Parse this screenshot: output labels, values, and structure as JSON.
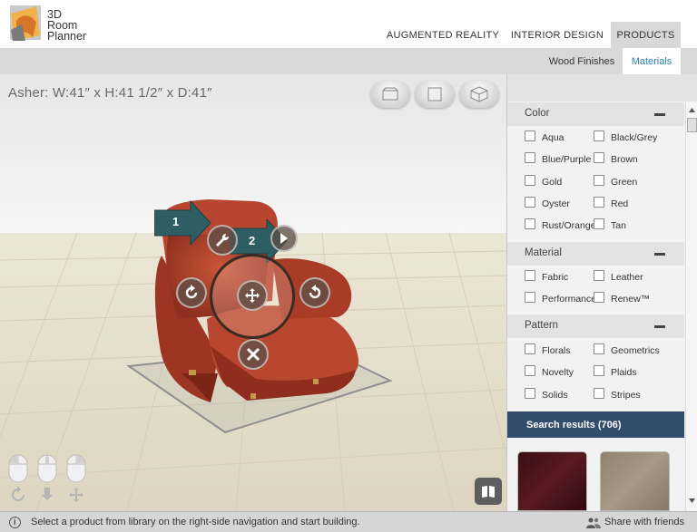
{
  "app": {
    "logo_text": [
      "3D",
      "Room",
      "Planner"
    ]
  },
  "top_nav": {
    "items": [
      "AUGMENTED REALITY",
      "INTERIOR DESIGN",
      "PRODUCTS"
    ],
    "active": "PRODUCTS"
  },
  "sub_nav": {
    "items": [
      "Wood Finishes",
      "Materials"
    ],
    "active": "Materials"
  },
  "viewport": {
    "product_label": "Asher: W:41″ x H:41 1/2″ x D:41″",
    "view_buttons": [
      "view-2d-icon",
      "view-top-icon",
      "view-3d-icon"
    ],
    "step_markers": [
      "1",
      "2"
    ],
    "controls": [
      "wrench-icon",
      "rotate-left-icon",
      "move-icon",
      "rotate-right-icon",
      "delete-icon",
      "next-arrow-icon"
    ],
    "mouse_hints": [
      "mouse-left-icon",
      "mouse-middle-icon",
      "mouse-right-icon"
    ]
  },
  "filters": {
    "sections": [
      {
        "title": "Color",
        "options": [
          "Aqua",
          "Black/Grey",
          "Blue/Purple",
          "Brown",
          "Gold",
          "Green",
          "Oyster",
          "Red",
          "Rust/Orange",
          "Tan"
        ]
      },
      {
        "title": "Material",
        "options": [
          "Fabric",
          "Leather",
          "Performance",
          "Renew™"
        ]
      },
      {
        "title": "Pattern",
        "options": [
          "Florals",
          "Geometrics",
          "Novelty",
          "Plaids",
          "Solids",
          "Stripes"
        ]
      }
    ]
  },
  "search_results": {
    "label": "Search results (706)"
  },
  "status_bar": {
    "message": "Select a product from library on the right-side navigation and start building.",
    "share_label": "Share with friends"
  },
  "colors": {
    "accent_blue": "#2c7eb6",
    "results_bar": "#324d6b",
    "step_marker": "#2e5e63",
    "chair": "#b8452f"
  }
}
